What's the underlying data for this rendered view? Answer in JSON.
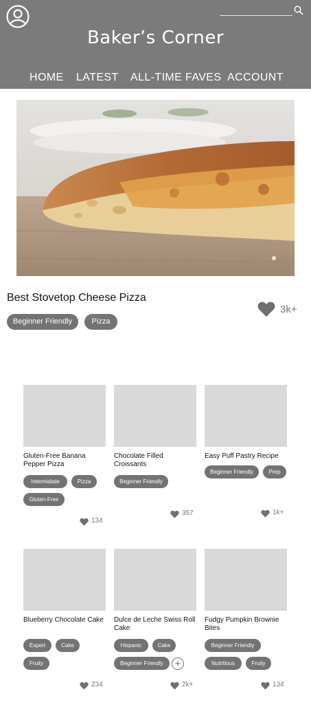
{
  "header": {
    "site_title": "Baker’s Corner",
    "search": {
      "placeholder": ""
    },
    "nav": [
      "HOME",
      "LATEST",
      "ALL-TIME FAVES",
      "ACCOUNT"
    ],
    "colors": {
      "header_bg": "#7b7b7b",
      "tag_bg": "#737373"
    }
  },
  "featured": {
    "title": "Best Stovetop Cheese Pizza",
    "tags": [
      "Beginner Friendly",
      "Pizza"
    ],
    "likes": "3k+",
    "image": "pizza-photo"
  },
  "recipes": [
    {
      "title": "Gluten-Free Banana Pepper Pizza",
      "tags": [
        "Intermidiate",
        "Pizza",
        "Gluten-Free"
      ],
      "likes": "134"
    },
    {
      "title": "Chocolate Filled Croissants",
      "tags": [
        "Beginner Friendly"
      ],
      "likes": "357"
    },
    {
      "title": "Easy Puff Pastry Recipe",
      "tags": [
        "Beginner Friendly",
        "Prep"
      ],
      "likes": "1k+"
    },
    {
      "title": "Blueberry Chocolate Cake",
      "tags": [
        "Expert",
        "Cake",
        "Fruity"
      ],
      "likes": "234"
    },
    {
      "title": "Dulce de Leche Swiss Roll Cake",
      "tags": [
        "Hispanic",
        "Cake",
        "Beginner Friendly"
      ],
      "likes": "2k+",
      "more_tags": "+"
    },
    {
      "title": "Fudgy Pumpkin Brownie Bites",
      "tags": [
        "Beginner Friendly",
        "Nutritious",
        "Fruity"
      ],
      "likes": "134"
    }
  ]
}
